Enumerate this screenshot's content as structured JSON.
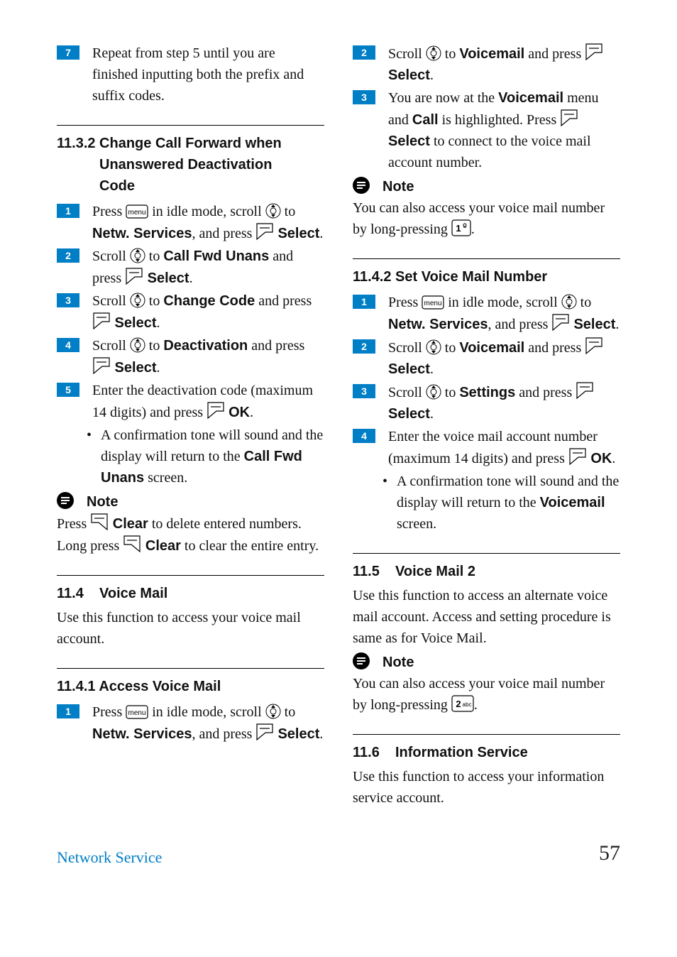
{
  "left": {
    "step7": "Repeat from step 5 until you are finished inputting both the prefix and suffix codes.",
    "h11_3_2_l1": "11.3.2 Change Call Forward when",
    "h11_3_2_l2": "Unanswered Deactivation",
    "h11_3_2_l3": "Code",
    "s1a": "Press ",
    "s1b": " in idle mode, scroll ",
    "s1c": " to ",
    "s1_netw": "Netw. Services",
    "s1d": ", and press ",
    "s1_sel": "Select",
    "s1e": ".",
    "s2a": "Scroll ",
    "s2b": " to ",
    "s2_cfu": "Call Fwd Unans",
    "s2c": " and press ",
    "s2_sel": " Select",
    "s2d": ".",
    "s3a": "Scroll ",
    "s3b": " to ",
    "s3_cc": "Change Code",
    "s3c": " and press ",
    "s3_sel": " Select",
    "s3d": ".",
    "s4a": "Scroll ",
    "s4b": " to ",
    "s4_de": "Deactivation",
    "s4c": " and press ",
    "s4_sel": " Select",
    "s4d": ".",
    "s5a": "Enter the deactivation code (maximum 14 digits) and press ",
    "s5_ok": "OK",
    "s5b": ".",
    "s5_bul": "A confirmation tone will sound and the display will return to the ",
    "s5_cfu": "Call Fwd Unans",
    "s5_scr": " screen.",
    "note": "Note",
    "note_a": "Press ",
    "note_clear": " Clear",
    "note_b": " to delete entered numbers. Long press ",
    "note_clear2": " Clear",
    "note_c": " to clear the entire entry.",
    "h11_4_num": "11.4",
    "h11_4_txt": "Voice Mail",
    "p11_4": "Use this function to access your voice mail account.",
    "h11_4_1": "11.4.1 Access Voice Mail",
    "vm1a": "Press ",
    "vm1b": " in idle mode, scroll ",
    "vm1c": " to ",
    "vm1_netw": "Netw. Services",
    "vm1d": ", and press ",
    "vm1_sel": "Select",
    "vm1e": "."
  },
  "right": {
    "s2a": "Scroll ",
    "s2b": " to ",
    "s2_vm": "Voicemail",
    "s2c": " and press ",
    "s2_sel": " Select",
    "s2d": ".",
    "s3a": "You are now at the ",
    "s3_vm": "Voicemail",
    "s3b": " menu and ",
    "s3_call": "Call",
    "s3c": " is highlighted. Press ",
    "s3_sel": " Select",
    "s3d": " to connect to the voice mail account number.",
    "note": "Note",
    "note_a": "You can also access your voice mail number by long-pressing ",
    "note_b": ".",
    "h11_4_2": "11.4.2 Set Voice Mail Number",
    "sv1a": "Press ",
    "sv1b": " in idle mode, scroll ",
    "sv1c": " to ",
    "sv1_netw": "Netw. Services",
    "sv1d": ", and press ",
    "sv1_sel": "Select",
    "sv1e": ".",
    "sv2a": "Scroll ",
    "sv2b": " to ",
    "sv2_vm": "Voicemail",
    "sv2c": " and press ",
    "sv2_sel": " Select",
    "sv2d": ".",
    "sv3a": "Scroll ",
    "sv3b": " to ",
    "sv3_set": "Settings",
    "sv3c": " and press ",
    "sv3_sel": " Select",
    "sv3d": ".",
    "sv4a": "Enter the voice mail account number (maximum 14 digits) and press ",
    "sv4_ok": " OK",
    "sv4b": ".",
    "sv4_bul": "A confirmation tone will sound and the display will return to the ",
    "sv4_vm": "Voicemail",
    "sv4_scr": " screen.",
    "h11_5_num": "11.5",
    "h11_5_txt": "Voice Mail 2",
    "p11_5": "Use this function to access an alternate voice mail account. Access and setting procedure is same as for Voice Mail.",
    "note2": "Note",
    "note2_a": "You can also access your voice mail number by long-pressing ",
    "note2_b": ".",
    "h11_6_num": "11.6",
    "h11_6_txt": "Information Service",
    "p11_6": "Use this function to access your information service account."
  },
  "footer": {
    "left": "Network Service",
    "right": "57"
  },
  "nums": {
    "1": "1",
    "2": "2",
    "3": "3",
    "4": "4",
    "5": "5",
    "7": "7"
  }
}
